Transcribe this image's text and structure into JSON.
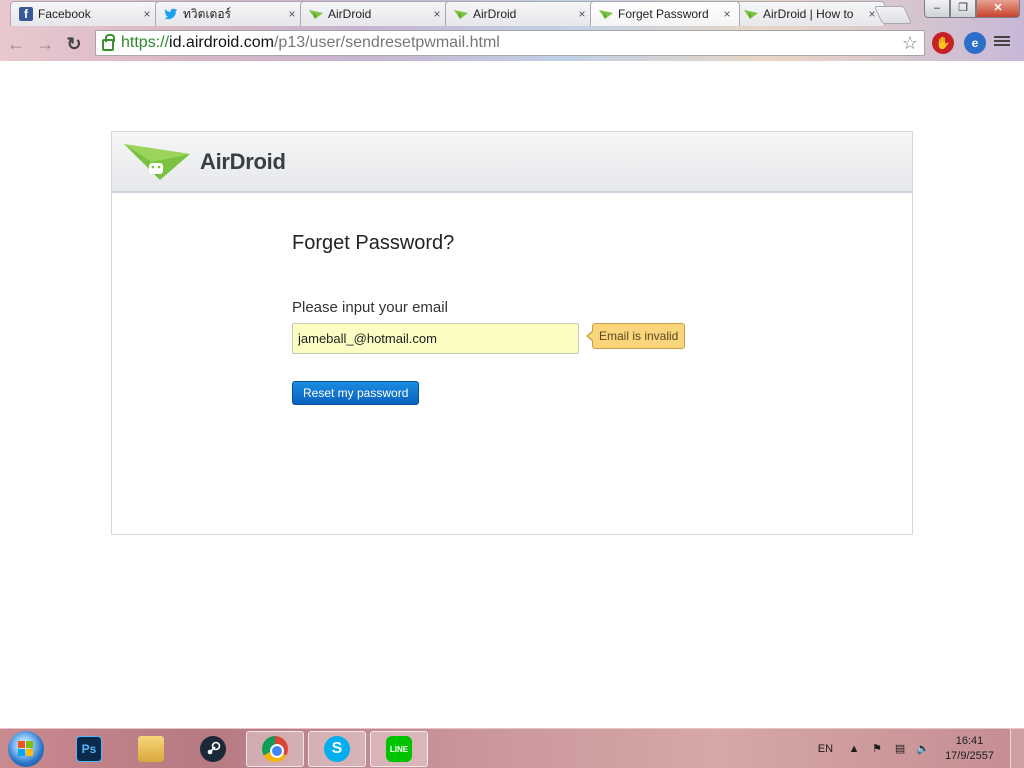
{
  "browser": {
    "tabs": [
      {
        "title": "Facebook",
        "icon": "facebook-icon"
      },
      {
        "title": "ทวิตเตอร์",
        "icon": "twitter-icon"
      },
      {
        "title": "AirDroid",
        "icon": "airdroid-icon"
      },
      {
        "title": "AirDroid",
        "icon": "airdroid-icon"
      },
      {
        "title": "Forget Password",
        "icon": "airdroid-icon"
      },
      {
        "title": "AirDroid | How to",
        "icon": "airdroid-icon"
      }
    ],
    "tab_close_glyph": "×",
    "address": {
      "scheme": "https://",
      "host": "id.airdroid.com",
      "path": "/p13/user/sendresetpwmail.html"
    },
    "window_controls": {
      "minimize": "–",
      "maximize": "❐",
      "close": "✕"
    }
  },
  "page": {
    "brand": "AirDroid",
    "title": "Forget Password?",
    "email_label": "Please input your email",
    "email_value": "jameball_@hotmail.com",
    "error_message": "Email is invalid",
    "submit_label": "Reset my password"
  },
  "taskbar": {
    "pinned": [
      {
        "name": "photoshop",
        "glyph": "Ps"
      },
      {
        "name": "file-explorer",
        "glyph": ""
      },
      {
        "name": "steam",
        "glyph": ""
      },
      {
        "name": "chrome",
        "glyph": ""
      },
      {
        "name": "skype",
        "glyph": "S"
      },
      {
        "name": "line",
        "glyph": "LINE"
      }
    ],
    "language": "EN",
    "time": "16:41",
    "date": "17/9/2557"
  },
  "colors": {
    "input_invalid_bg": "#fbfdc2",
    "error_tip_bg": "#fbd57b",
    "button_blue": "#0a62bf",
    "brand_green": "#7cc242"
  }
}
